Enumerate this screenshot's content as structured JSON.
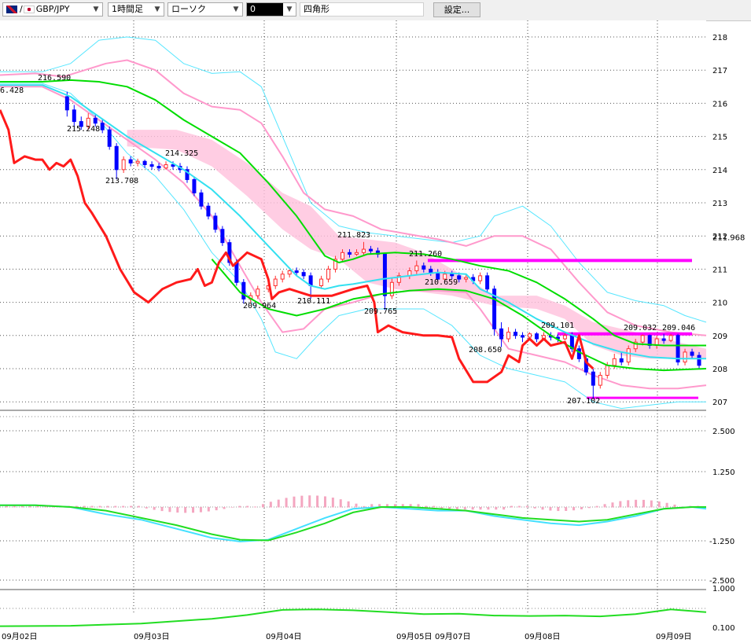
{
  "toolbar": {
    "pair": "GBP/JPY",
    "timeframe": "1時間足",
    "chart_type": "ローソク",
    "color_swatch": "0",
    "drawing_tool": "四角形",
    "settings_label": "設定..."
  },
  "chart_data": [
    {
      "type": "candlestick",
      "panel": "price",
      "y_ticks": [
        218,
        217,
        216,
        215,
        214,
        213,
        212,
        211,
        210,
        209,
        208,
        207
      ],
      "ylim": [
        206.6,
        218.6
      ],
      "x_labels": [
        "09月02日",
        "09月03日",
        "09月04日",
        "09月05日",
        "09月07日",
        "09月08日",
        "09月09日"
      ],
      "current_price": "211.968",
      "annotations": [
        "216.590",
        "6.428",
        "215.248",
        "214.325",
        "213.708",
        "211.823",
        "211.260",
        "210.659",
        "209.964",
        "210.111",
        "209.765",
        "209.101",
        "208.650",
        "209.032",
        "209.046",
        "207.102"
      ],
      "colors": {
        "up": "#ff2d2d",
        "down": "#0000ff",
        "chikou": "#ff1a1a",
        "tenkan": "#00dd00",
        "kijun": "#33e0f0",
        "bb_inner": "#ff99cc",
        "bb_outer": "#55e6ff",
        "cloud": "#ffc0dc",
        "hline": "#ff00ff"
      }
    },
    {
      "type": "macd",
      "panel": "macd",
      "y_ticks": [
        "2.500",
        "1.250",
        "-1.250",
        "-2.500"
      ],
      "ylim": [
        -2.5,
        2.5
      ]
    },
    {
      "type": "line",
      "panel": "sub",
      "y_ticks": [
        "1.000",
        "0.100"
      ],
      "ylim": [
        0.1,
        1.0
      ]
    }
  ]
}
